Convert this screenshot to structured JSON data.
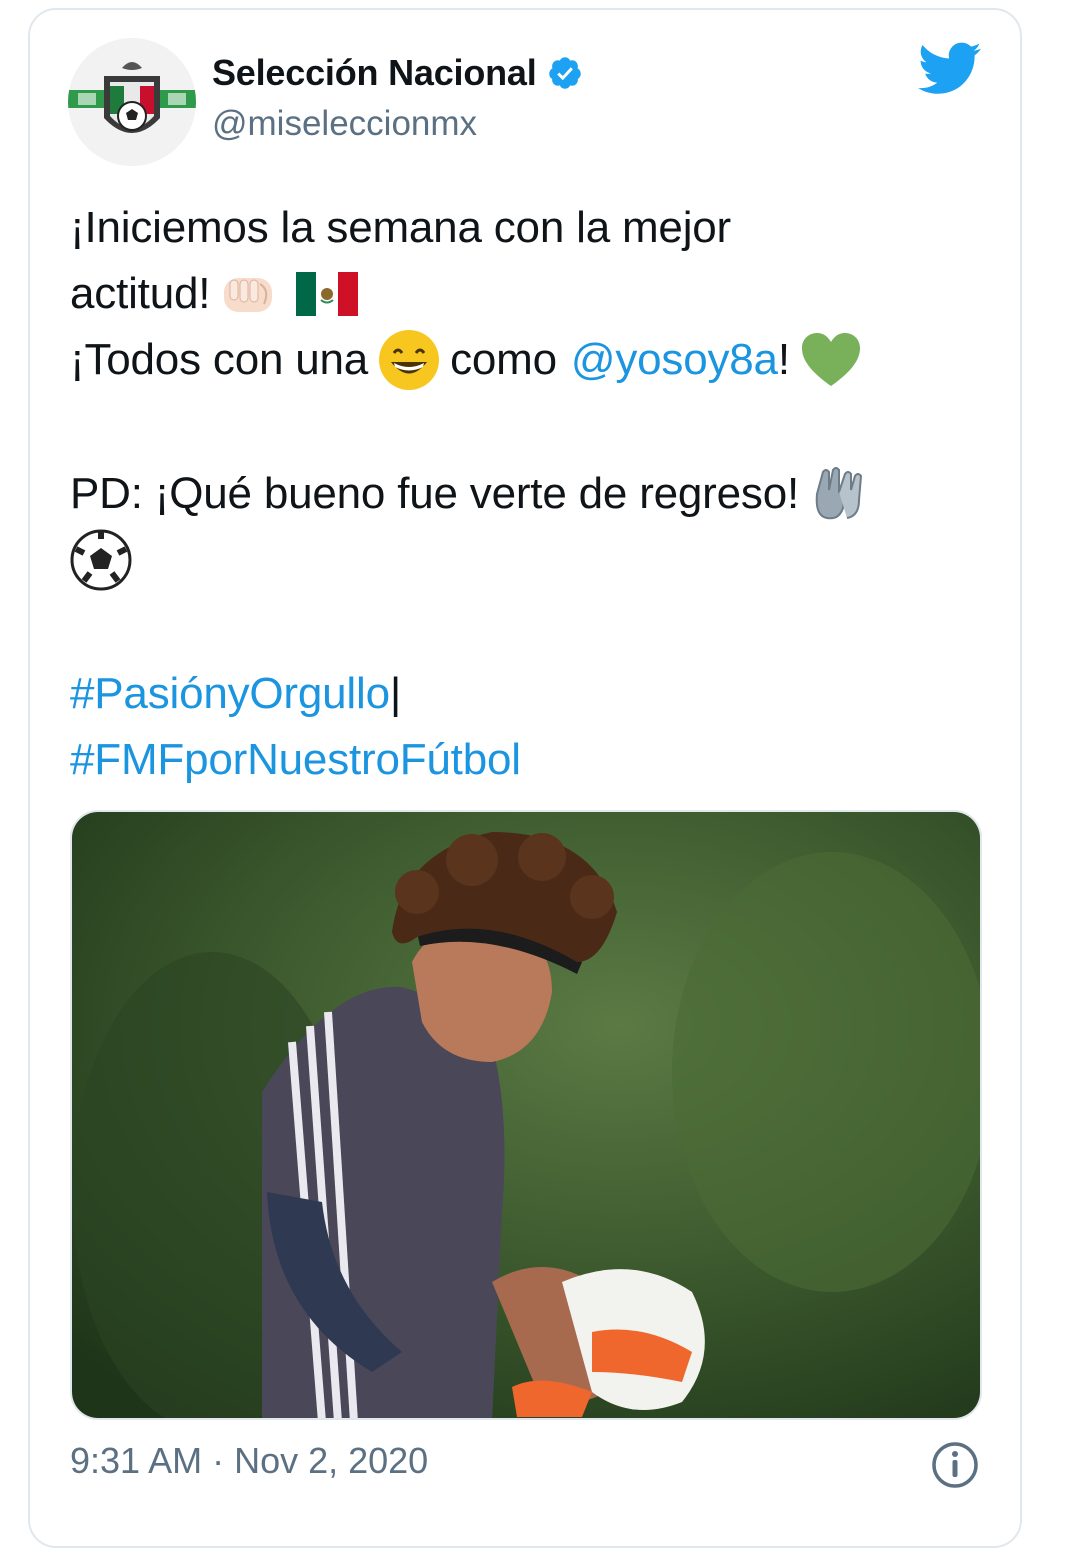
{
  "tweet": {
    "author_name": "Selección Nacional",
    "author_handle": "@miseleccionmx",
    "lines": {
      "l1": "¡Iniciemos la semana con la mejor",
      "l2": "actitud!",
      "l3a": "¡Todos con una",
      "l3b": "como",
      "l3mention": "@yosoy8a",
      "l3c": "!",
      "l4": "PD: ¡Qué bueno fue verte de regreso!",
      "hashtag1": "#PasiónyOrgullo",
      "separator": " |",
      "hashtag2": "#FMFporNuestroFútbol"
    },
    "timestamp": "9:31 AM · Nov 2, 2020"
  },
  "colors": {
    "link": "#1b95e0",
    "twitter_blue": "#1da1f2",
    "secondary_text": "#5b7083"
  },
  "icons": {
    "verified": "verified-badge-icon",
    "twitter": "twitter-bird-icon",
    "info": "info-icon",
    "emoji_fist": "oncoming-fist-emoji",
    "emoji_flag": "mexico-flag-emoji",
    "emoji_grin": "grinning-face-emoji",
    "emoji_heart": "green-heart-emoji",
    "emoji_gloves": "gloves-emoji",
    "emoji_ball": "soccer-ball-emoji"
  }
}
